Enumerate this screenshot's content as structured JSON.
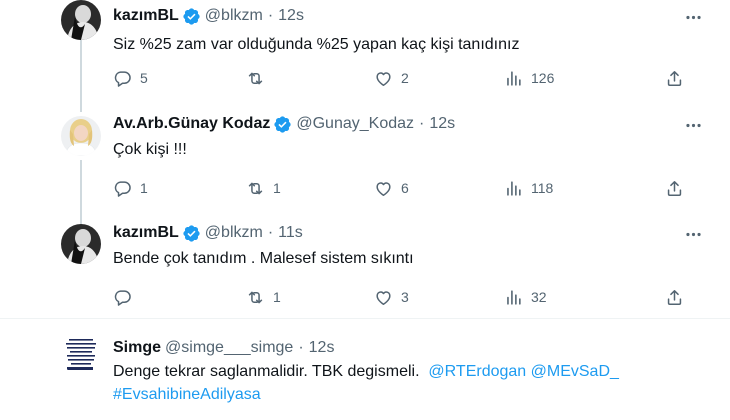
{
  "tweets": [
    {
      "name": "kazımBL",
      "handle": "@blkzm",
      "time": "12s",
      "verified": true,
      "text": "Siz %25 zam var olduğunda %25 yapan kaç kişi tanıdınız",
      "replies": "5",
      "retweets": "",
      "likes": "2",
      "views": "126"
    },
    {
      "name": "Av.Arb.Günay Kodaz",
      "handle": "@Gunay_Kodaz",
      "time": "12s",
      "verified": true,
      "text": "Çok kişi !!!",
      "replies": "1",
      "retweets": "1",
      "likes": "6",
      "views": "118"
    },
    {
      "name": "kazımBL",
      "handle": "@blkzm",
      "time": "11s",
      "verified": true,
      "text": "Bende çok tanıdım . Malesef sistem sıkıntı",
      "replies": "",
      "retweets": "1",
      "likes": "3",
      "views": "32"
    },
    {
      "name": "Simge",
      "handle": "@simge___simge",
      "time": "12s",
      "verified": false,
      "text_line1": "Denge tekrar saglanmalidir. TBK degismeli.",
      "mention1": "@RTErdogan",
      "mention2": "@MEvSaD_",
      "hashtag": "#EvsahibineAdilyasa"
    }
  ],
  "separator_dot": "·",
  "colors": {
    "text": "#0f1419",
    "secondary": "#536471",
    "link": "#1d9bf0",
    "verified": "#1d9bf0",
    "divider": "#eff3f4"
  },
  "icons": [
    "more-icon",
    "reply-icon",
    "retweet-icon",
    "like-icon",
    "views-icon",
    "share-icon",
    "verified-badge-icon"
  ]
}
